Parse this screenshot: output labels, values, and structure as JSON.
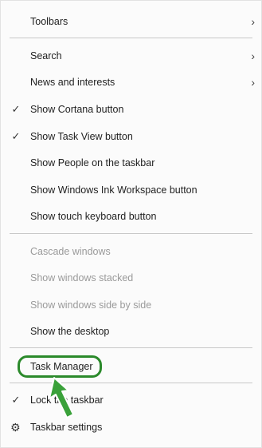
{
  "menu": {
    "items": [
      {
        "label": "Toolbars",
        "checked": false,
        "submenu": true,
        "disabled": false
      },
      {
        "label": "Search",
        "checked": false,
        "submenu": true,
        "disabled": false
      },
      {
        "label": "News and interests",
        "checked": false,
        "submenu": true,
        "disabled": false
      },
      {
        "label": "Show Cortana button",
        "checked": true,
        "submenu": false,
        "disabled": false
      },
      {
        "label": "Show Task View button",
        "checked": true,
        "submenu": false,
        "disabled": false
      },
      {
        "label": "Show People on the taskbar",
        "checked": false,
        "submenu": false,
        "disabled": false
      },
      {
        "label": "Show Windows Ink Workspace button",
        "checked": false,
        "submenu": false,
        "disabled": false
      },
      {
        "label": "Show touch keyboard button",
        "checked": false,
        "submenu": false,
        "disabled": false
      },
      {
        "label": "Cascade windows",
        "checked": false,
        "submenu": false,
        "disabled": true
      },
      {
        "label": "Show windows stacked",
        "checked": false,
        "submenu": false,
        "disabled": true
      },
      {
        "label": "Show windows side by side",
        "checked": false,
        "submenu": false,
        "disabled": true
      },
      {
        "label": "Show the desktop",
        "checked": false,
        "submenu": false,
        "disabled": false
      },
      {
        "label": "Task Manager",
        "checked": false,
        "submenu": false,
        "disabled": false
      },
      {
        "label": "Lock the taskbar",
        "checked": true,
        "submenu": false,
        "disabled": false
      },
      {
        "label": "Taskbar settings",
        "checked": false,
        "submenu": false,
        "disabled": false
      }
    ],
    "check_glyph": "✓",
    "chevron_glyph": "›",
    "gear_glyph": "⚙"
  },
  "annotation": {
    "highlight_color": "#2b8a2b",
    "highlight_target": "Task Manager",
    "arrow_icon": "pointer-arrow-icon"
  }
}
